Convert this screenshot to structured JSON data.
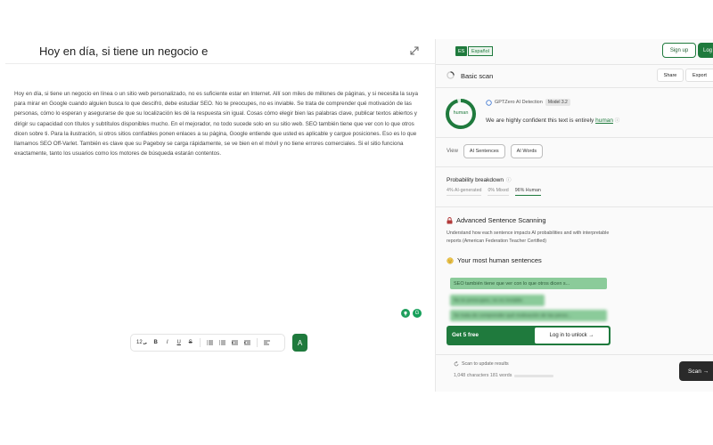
{
  "editor": {
    "title": "Hoy en día, si tiene un negocio e",
    "body": "Hoy en día, si tiene un negocio en línea o un sitio web personalizado, no es suficiente estar en Internet. Allí son miles de millones de páginas, y si necesita la suya para mirar en Google cuando alguien busca lo que descifró, debe estudiar SEO. No te preocupes, no es inviable. Se trata de comprender qué motivación de las personas, cómo lo esperan y asegurarse de que su localización les dé la respuesta sin igual. Cosas cómo elegir bien las palabras clave, publicar textos abiertos y dirigir su capacidad con títulos y subtítulos disponibles mucho. En el mejorador, no todo sucede solo en su sitio web. SEO también tiene que ver con lo que otros dicen sobre ti. Para la ilustración, si otros sitios confiables ponen enlaces a su página, Google entiende que usted es aplicable y cargue posiciones. Eso es lo que llamamos SEO Off-Varlet. También es clave que su Pageboy se carga rápidamente, se ve bien en el móvil y no tiene errores comerciales. Si el sitio funciona exactamente, tanto los usuarios como los motores de búsqueda estarán contentos.",
    "expand_icon": "expand-icon",
    "toolbar": {
      "font_size": "12",
      "bold": "B",
      "italic": "I",
      "underline": "U",
      "strike": "S"
    },
    "spell_label": "A"
  },
  "panel": {
    "lang_code": "ES",
    "lang_name": "Español",
    "signup": "Sign up",
    "login": "Log",
    "basic_scan": "Basic scan",
    "share": "Share",
    "export": "Export",
    "gauge_label": "human",
    "gauge_fraction": 0.96,
    "detector": "GPTZero AI Detection",
    "model": "Model 3.2",
    "confidence_prefix": "We are highly confident this text is entirely",
    "confidence_word": "human",
    "view_label": "View",
    "view_buttons": [
      "AI Sentences",
      "AI Words"
    ],
    "prob_title": "Probability breakdown",
    "prob": {
      "ai": "4% AI-generated",
      "mixed": "0% Mixed",
      "human": "96% Human"
    },
    "adv_title": "Advanced Sentence Scanning",
    "adv_desc": "Understand how each sentence impacts AI probabilities and with interpretable reports (American Federation Teacher Certified)",
    "most_human": "Your most human sentences",
    "sentences": [
      "SEO también tiene que ver con lo que otros dicen s...",
      "No te preocupes, no es inviable.",
      "Se trata de comprender qué motivación de las perso..."
    ],
    "cta_text": "Get 5 free",
    "unlock": "Log in to unlock →",
    "update_text": "Scan to update results",
    "char_count": "1,048 characters 181 words",
    "scan": "Scan →",
    "colors": {
      "accent": "#1f7a3d",
      "highlight": "#8bcb9a",
      "dark_button": "#2a2a2a"
    }
  }
}
